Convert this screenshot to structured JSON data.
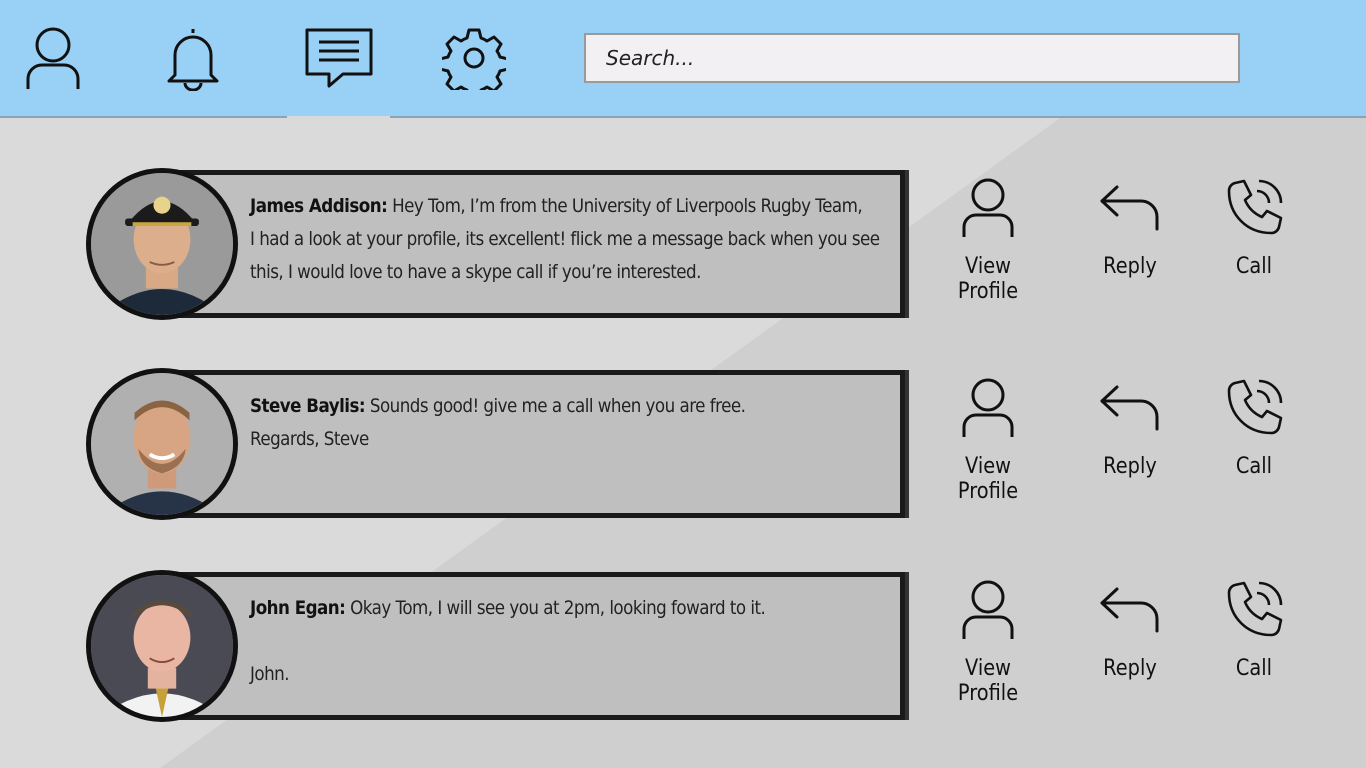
{
  "header": {
    "nav": [
      {
        "icon": "user-icon"
      },
      {
        "icon": "bell-icon"
      },
      {
        "icon": "message-icon",
        "active": true
      },
      {
        "icon": "gear-icon"
      }
    ],
    "search_placeholder": "Search..."
  },
  "actions": {
    "view_profile": "View Profile",
    "reply": "Reply",
    "call": "Call"
  },
  "messages": [
    {
      "sender": "James Addison:",
      "lines": [
        "Hey Tom, I’m from the University of Liverpools Rugby Team,",
        "I had a look at your profile, its excellent! flick me a message back when you see",
        "this, I would love to have a skype call if you’re interested."
      ],
      "avatar": "avatar-cap"
    },
    {
      "sender": "Steve Baylis:",
      "lines": [
        "Sounds good! give me a call when you are free.",
        "Regards, Steve"
      ],
      "avatar": "avatar-beard"
    },
    {
      "sender": "John Egan:",
      "lines": [
        "Okay Tom, I will see you at 2pm, looking foward to it.",
        "",
        "John."
      ],
      "avatar": "avatar-suit"
    }
  ],
  "colors": {
    "header_bg": "#99d0f5",
    "page_bg": "#d9d9d9",
    "bubble_bg": "#bfbfbf",
    "border": "#1a1a1a"
  }
}
